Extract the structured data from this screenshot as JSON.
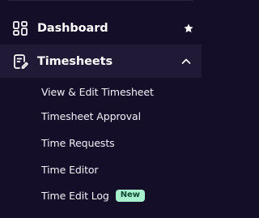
{
  "nav": {
    "dashboard": {
      "label": "Dashboard",
      "icon": "dashboard-grid-icon",
      "action_icon": "star-icon"
    },
    "timesheets": {
      "label": "Timesheets",
      "icon": "timesheet-edit-icon",
      "expanded": true,
      "toggle_icon": "chevron-up-icon",
      "items": [
        {
          "label": "View & Edit Timesheet"
        },
        {
          "label": "Timesheet Approval"
        },
        {
          "label": "Time Requests"
        },
        {
          "label": "Time Editor"
        },
        {
          "label": "Time Edit Log",
          "badge": "New"
        }
      ]
    }
  },
  "colors": {
    "background": "#150e29",
    "active_background": "#211a37",
    "badge_background": "#a8f0cd",
    "badge_text": "#0f4a33"
  }
}
